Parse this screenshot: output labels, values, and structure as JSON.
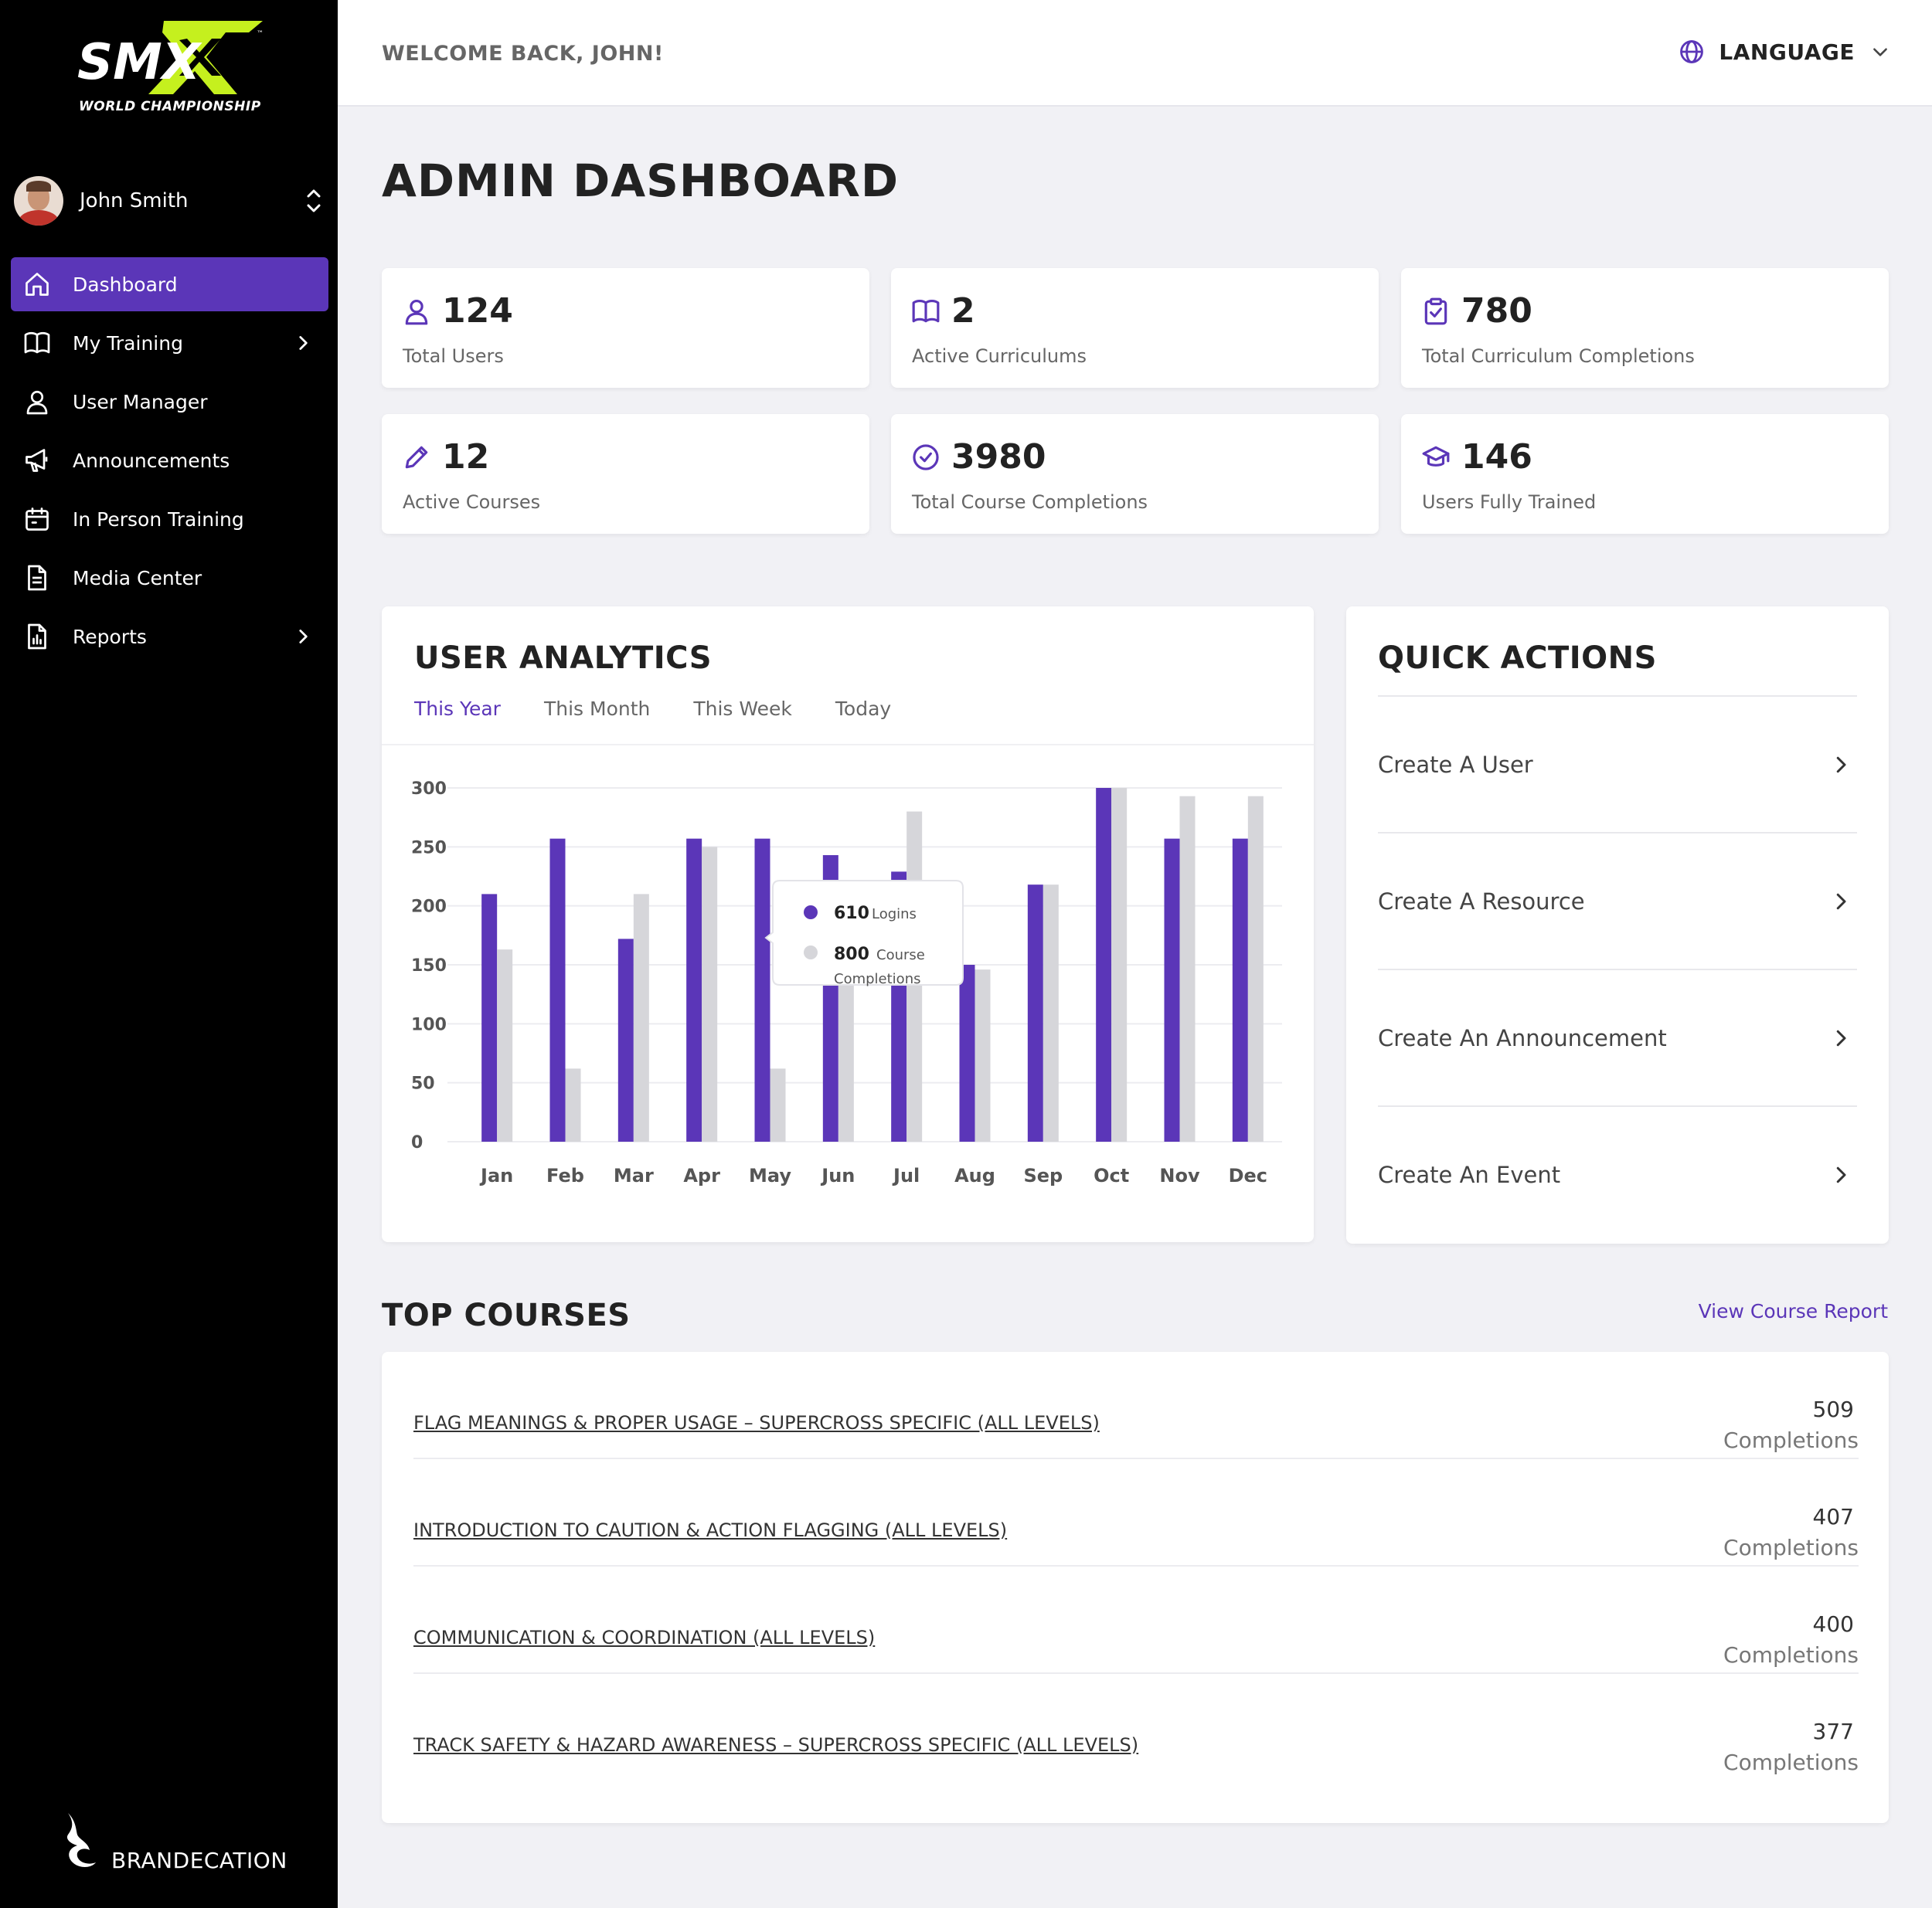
{
  "sidebar": {
    "logo_text": "SMX",
    "logo_sub": "WORLD CHAMPIONSHIP",
    "user_name": "John Smith",
    "items": [
      {
        "label": "Dashboard",
        "icon": "home-icon",
        "active": true
      },
      {
        "label": "My Training",
        "icon": "book-icon",
        "has_chevron": true
      },
      {
        "label": "User Manager",
        "icon": "user-icon"
      },
      {
        "label": "Announcements",
        "icon": "megaphone-icon"
      },
      {
        "label": "In Person Training",
        "icon": "calendar-icon"
      },
      {
        "label": "Media Center",
        "icon": "document-icon"
      },
      {
        "label": "Reports",
        "icon": "report-icon",
        "has_chevron": true
      }
    ],
    "brand": "BRANDECATION"
  },
  "header": {
    "welcome": "WELCOME BACK, JOHN!",
    "language_label": "LANGUAGE"
  },
  "page_title": "ADMIN DASHBOARD",
  "stats": [
    {
      "value": "124",
      "label": "Total Users",
      "icon": "user-icon"
    },
    {
      "value": "2",
      "label": "Active Curriculums",
      "icon": "book-open-icon"
    },
    {
      "value": "780",
      "label": "Total Curriculum Completions",
      "icon": "clipboard-check-icon"
    },
    {
      "value": "12",
      "label": "Active Courses",
      "icon": "pencil-icon"
    },
    {
      "value": "3980",
      "label": "Total Course Completions",
      "icon": "check-circle-icon"
    },
    {
      "value": "146",
      "label": "Users Fully Trained",
      "icon": "graduation-cap-icon"
    }
  ],
  "analytics": {
    "title": "USER ANALYTICS",
    "tabs": [
      "This Year",
      "This Month",
      "This Week",
      "Today"
    ],
    "active_tab": "This Year",
    "tooltip": {
      "logins_value": "610",
      "logins_label": "Logins",
      "completions_value": "800",
      "completions_label_1": "Course",
      "completions_label_2": "Completions"
    }
  },
  "chart_data": {
    "type": "bar",
    "categories": [
      "Jan",
      "Feb",
      "Mar",
      "Apr",
      "May",
      "Jun",
      "Jul",
      "Aug",
      "Sep",
      "Oct",
      "Nov",
      "Dec"
    ],
    "series": [
      {
        "values": [
          210,
          257,
          172,
          257,
          257,
          243,
          229,
          150,
          218,
          300,
          257,
          257
        ],
        "color": "#5b36b8"
      },
      {
        "values": [
          163,
          62,
          210,
          250,
          62,
          175,
          280,
          146,
          218,
          300,
          293,
          293
        ],
        "color": "#d6d6da"
      }
    ],
    "yticks": [
      0,
      50,
      100,
      150,
      200,
      250,
      300
    ],
    "ylim": [
      0,
      300
    ],
    "grid": true
  },
  "quick_actions": {
    "title": "QUICK ACTIONS",
    "items": [
      "Create A User",
      "Create A Resource",
      "Create An Announcement",
      "Create An Event"
    ]
  },
  "top_courses": {
    "title": "TOP COURSES",
    "view_report": "View Course Report",
    "unit": "Completions",
    "rows": [
      {
        "name": "FLAG MEANINGS & PROPER USAGE – SUPERCROSS SPECIFIC (ALL LEVELS)",
        "count": "509"
      },
      {
        "name": "INTRODUCTION TO CAUTION & ACTION FLAGGING (ALL LEVELS)",
        "count": "407"
      },
      {
        "name": "COMMUNICATION & COORDINATION (ALL LEVELS)",
        "count": "400"
      },
      {
        "name": "TRACK SAFETY & HAZARD AWARENESS – SUPERCROSS SPECIFIC (ALL LEVELS)",
        "count": "377"
      }
    ]
  },
  "colors": {
    "accent": "#5b36b8",
    "secondary_bar": "#d6d6da",
    "logo_green": "#c5f01e"
  }
}
